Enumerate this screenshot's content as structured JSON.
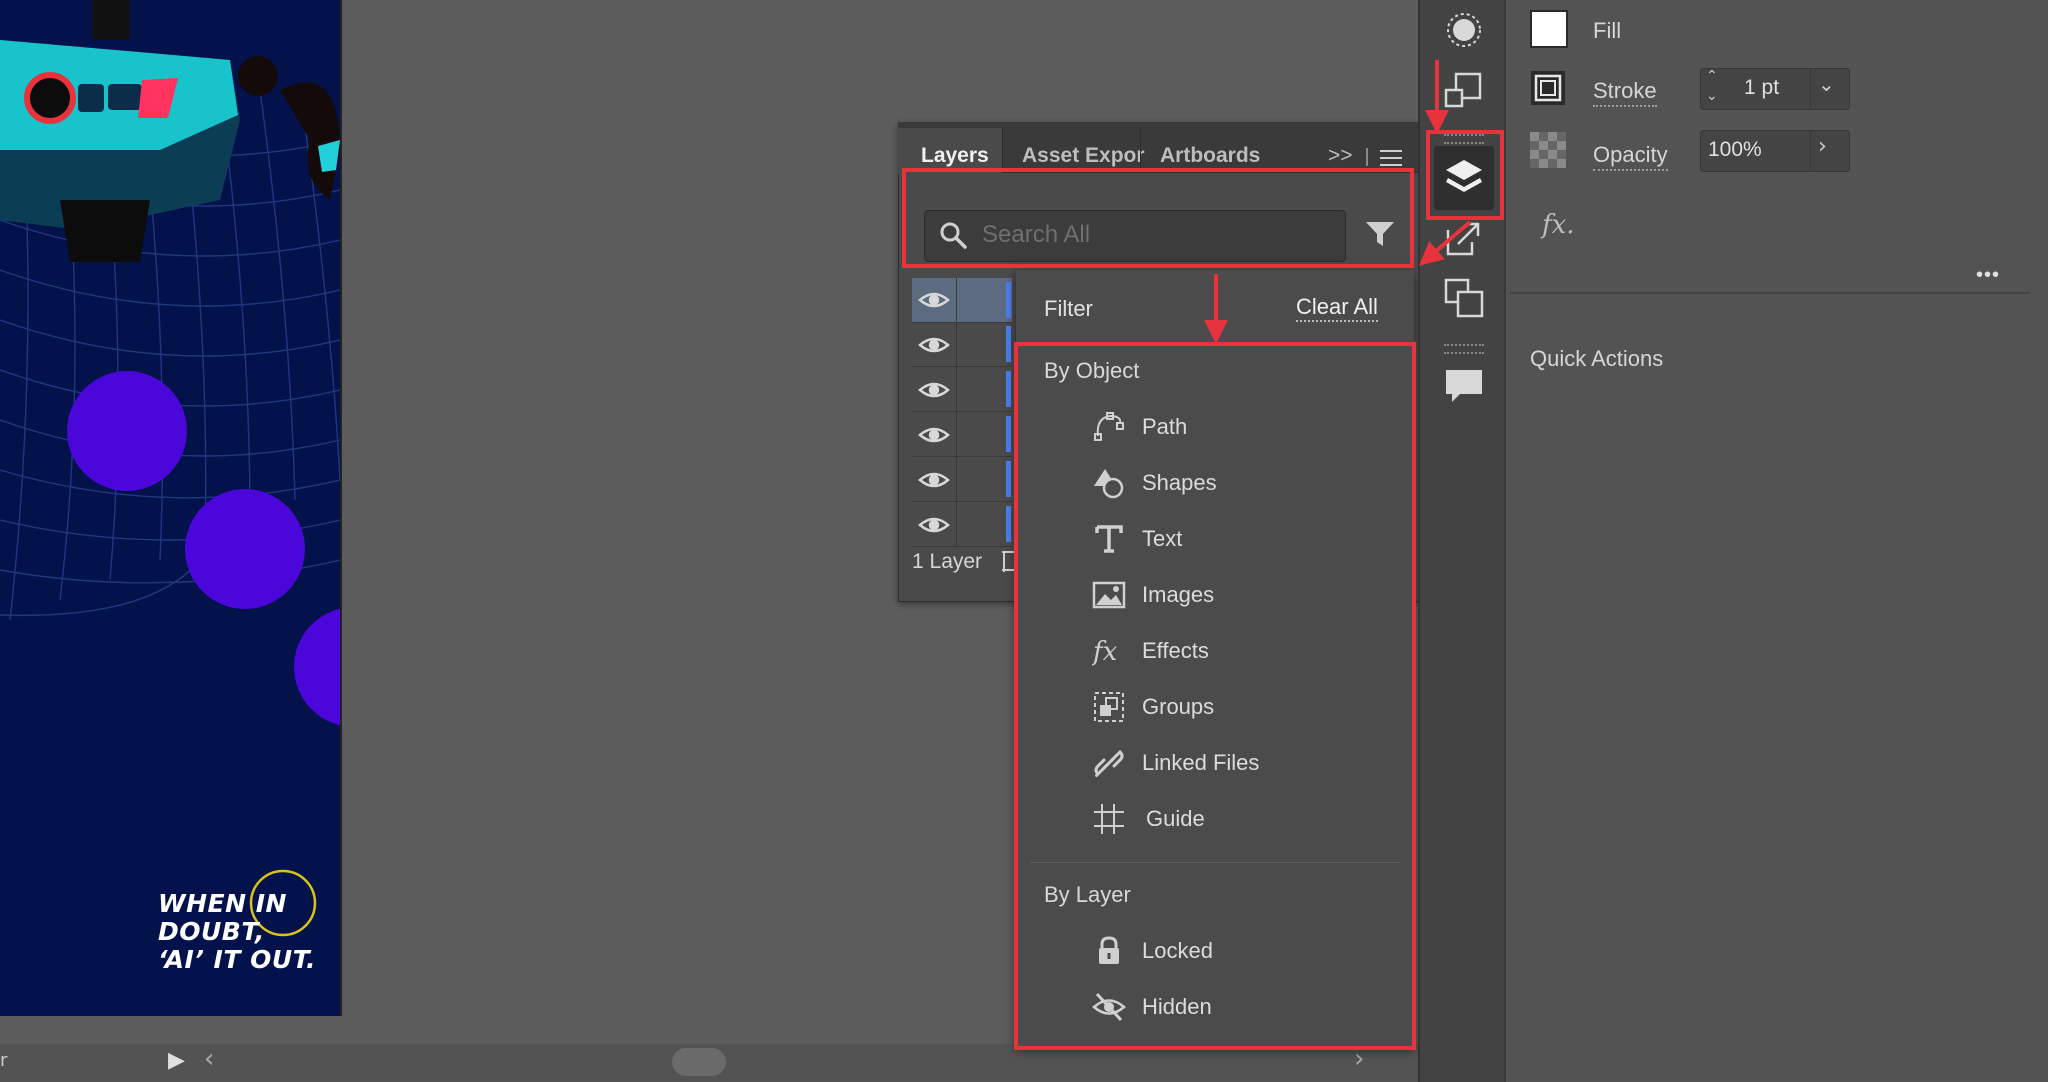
{
  "artboard": {
    "poster_lines": [
      "WHEN IN",
      "DOUBT,",
      "‘AI’ IT OUT."
    ]
  },
  "layers_panel": {
    "tabs": [
      {
        "label": "Layers",
        "active": true
      },
      {
        "label": "Asset Expor",
        "active": false
      },
      {
        "label": "Artboards",
        "active": false
      }
    ],
    "overflow_label": ">>",
    "search_placeholder": "Search All",
    "layer_count": "1 Layer",
    "rows": 6
  },
  "filter_menu": {
    "title": "Filter",
    "clear_all": "Clear All",
    "by_object_heading": "By Object",
    "by_object_items": [
      {
        "label": "Path",
        "icon": "path-icon"
      },
      {
        "label": "Shapes",
        "icon": "shapes-icon"
      },
      {
        "label": "Text",
        "icon": "text-icon"
      },
      {
        "label": "Images",
        "icon": "image-icon"
      },
      {
        "label": "Effects",
        "icon": "effects-icon"
      },
      {
        "label": "Groups",
        "icon": "group-icon"
      },
      {
        "label": "Linked Files",
        "icon": "link-icon"
      },
      {
        "label": "Guide",
        "icon": "guide-icon"
      }
    ],
    "by_layer_heading": "By Layer",
    "by_layer_items": [
      {
        "label": "Locked",
        "icon": "lock-icon"
      },
      {
        "label": "Hidden",
        "icon": "hidden-icon"
      }
    ]
  },
  "properties": {
    "fill_label": "Fill",
    "stroke_label": "Stroke",
    "stroke_value": "1 pt",
    "opacity_label": "Opacity",
    "opacity_value": "100%",
    "fx_label": "fx.",
    "more_label": "•••",
    "quick_actions_label": "Quick Actions"
  },
  "colors": {
    "annotation_red": "#e8333d",
    "layer_color_bar": "#4c7df0",
    "artboard_bg": "#03124a",
    "circle_purple": "#4b06d9"
  }
}
